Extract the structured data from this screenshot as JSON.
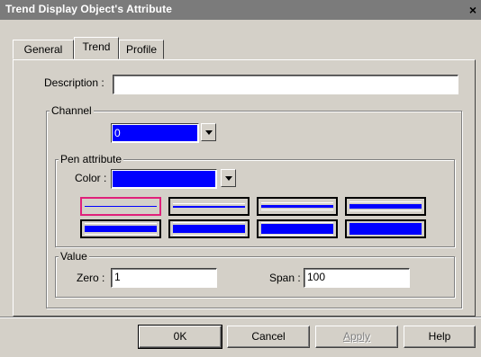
{
  "window": {
    "title": "Trend Display Object's Attribute",
    "close_label": "×"
  },
  "tabs": [
    {
      "label": "General"
    },
    {
      "label": "Trend"
    },
    {
      "label": "Profile"
    }
  ],
  "description": {
    "label": "Description :",
    "value": ""
  },
  "channel": {
    "group_title": "Channel",
    "selected": "0"
  },
  "pen": {
    "group_title": "Pen attribute",
    "color_label": "Color :",
    "color_value": "#0000ff",
    "selected_index": 0
  },
  "value": {
    "group_title": "Value",
    "zero_label": "Zero :",
    "zero_value": "1",
    "span_label": "Span :",
    "span_value": "100"
  },
  "buttons": {
    "ok": "0K",
    "cancel": "Cancel",
    "apply": "Apply",
    "help": "Help"
  },
  "colors": {
    "titlebar": "#7b7b7b",
    "selection": "#0000ff",
    "pen_selected_border": "#e0207a"
  }
}
